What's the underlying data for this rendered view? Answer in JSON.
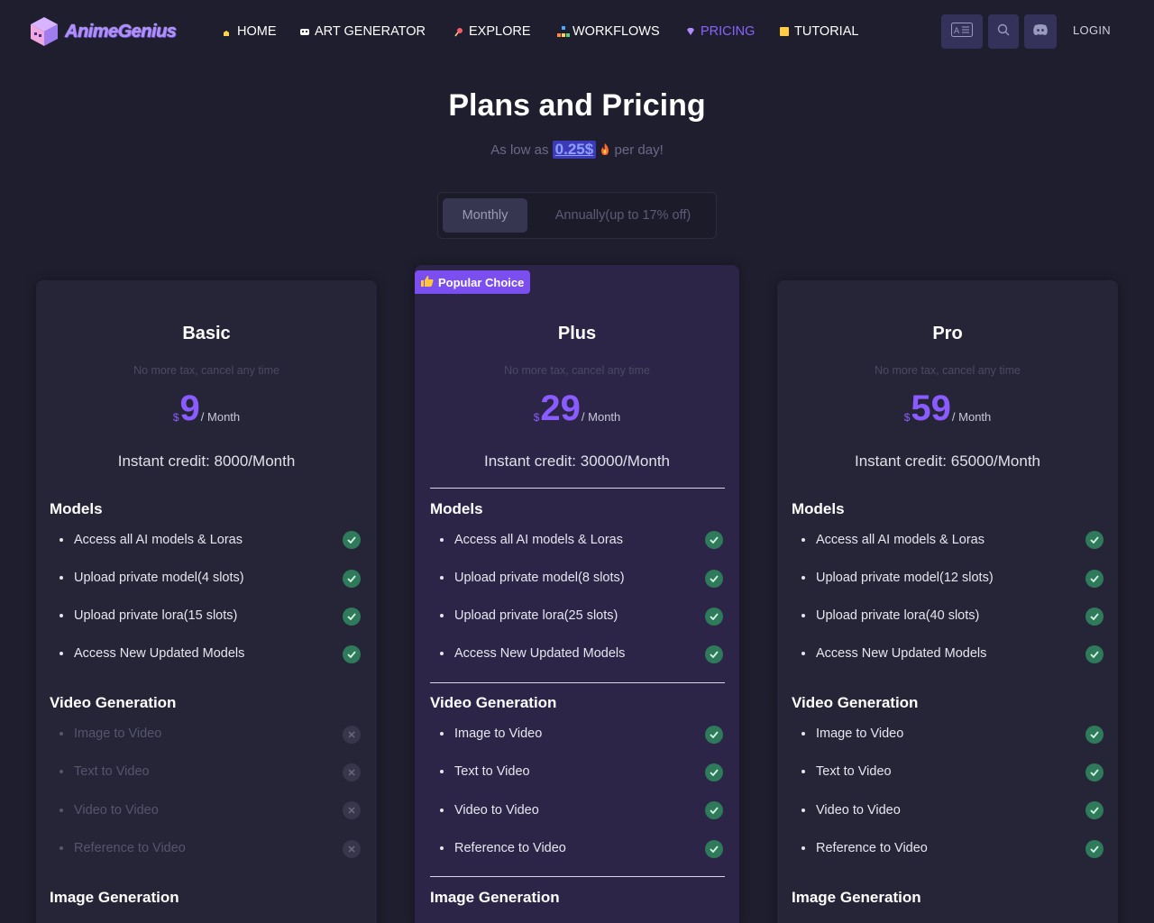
{
  "header": {
    "logo_text": "AnimeGenius",
    "nav": [
      {
        "label": "HOME",
        "icon": "home-icon",
        "active": false
      },
      {
        "label": "ART GENERATOR",
        "icon": "robot-icon",
        "active": false
      },
      {
        "label": "EXPLORE",
        "icon": "pin-icon",
        "active": false
      },
      {
        "label": "WORKFLOWS",
        "icon": "workflow-icon",
        "active": false
      },
      {
        "label": "PRICING",
        "icon": "diamond-icon",
        "active": true
      },
      {
        "label": "TUTORIAL",
        "icon": "book-icon",
        "active": false
      }
    ],
    "login_label": "LOGIN",
    "accent": "#8a63ff"
  },
  "page": {
    "title": "Plans and Pricing",
    "subtitle_prefix": "As low as",
    "subtitle_price": "0.25$",
    "subtitle_suffix": "per day!"
  },
  "billing_toggle": {
    "monthly": "Monthly",
    "annually": "Annually(up to 17% off)"
  },
  "plans": [
    {
      "name": "Basic",
      "note": "No more tax, cancel any time",
      "currency": "$",
      "price": "9",
      "period": "/ Month",
      "credit": "Instant credit: 8000/Month",
      "sections": [
        {
          "title": "Models",
          "features": [
            {
              "label": "Access all AI models & Loras",
              "included": true
            },
            {
              "label": "Upload private model(4 slots)",
              "included": true
            },
            {
              "label": "Upload private lora(15 slots)",
              "included": true
            },
            {
              "label": "Access New Updated Models",
              "included": true
            }
          ]
        },
        {
          "title": "Video Generation",
          "features": [
            {
              "label": "Image to Video",
              "included": false
            },
            {
              "label": "Text to Video",
              "included": false
            },
            {
              "label": "Video to Video",
              "included": false
            },
            {
              "label": "Reference to Video",
              "included": false
            }
          ]
        },
        {
          "title": "Image Generation",
          "features": []
        }
      ]
    },
    {
      "name": "Plus",
      "badge": "Popular Choice",
      "note": "No more tax, cancel any time",
      "currency": "$",
      "price": "29",
      "period": "/ Month",
      "credit": "Instant credit: 30000/Month",
      "sections": [
        {
          "title": "Models",
          "features": [
            {
              "label": "Access all AI models & Loras",
              "included": true
            },
            {
              "label": "Upload private model(8 slots)",
              "included": true
            },
            {
              "label": "Upload private lora(25 slots)",
              "included": true
            },
            {
              "label": "Access New Updated Models",
              "included": true
            }
          ]
        },
        {
          "title": "Video Generation",
          "features": [
            {
              "label": "Image to Video",
              "included": true
            },
            {
              "label": "Text to Video",
              "included": true
            },
            {
              "label": "Video to Video",
              "included": true
            },
            {
              "label": "Reference to Video",
              "included": true
            }
          ]
        },
        {
          "title": "Image Generation",
          "features": []
        }
      ]
    },
    {
      "name": "Pro",
      "note": "No more tax, cancel any time",
      "currency": "$",
      "price": "59",
      "period": "/ Month",
      "credit": "Instant credit: 65000/Month",
      "sections": [
        {
          "title": "Models",
          "features": [
            {
              "label": "Access all AI models & Loras",
              "included": true
            },
            {
              "label": "Upload private model(12 slots)",
              "included": true
            },
            {
              "label": "Upload private lora(40 slots)",
              "included": true
            },
            {
              "label": "Access New Updated Models",
              "included": true
            }
          ]
        },
        {
          "title": "Video Generation",
          "features": [
            {
              "label": "Image to Video",
              "included": true
            },
            {
              "label": "Text to Video",
              "included": true
            },
            {
              "label": "Video to Video",
              "included": true
            },
            {
              "label": "Reference to Video",
              "included": true
            }
          ]
        },
        {
          "title": "Image Generation",
          "features": []
        }
      ]
    }
  ]
}
